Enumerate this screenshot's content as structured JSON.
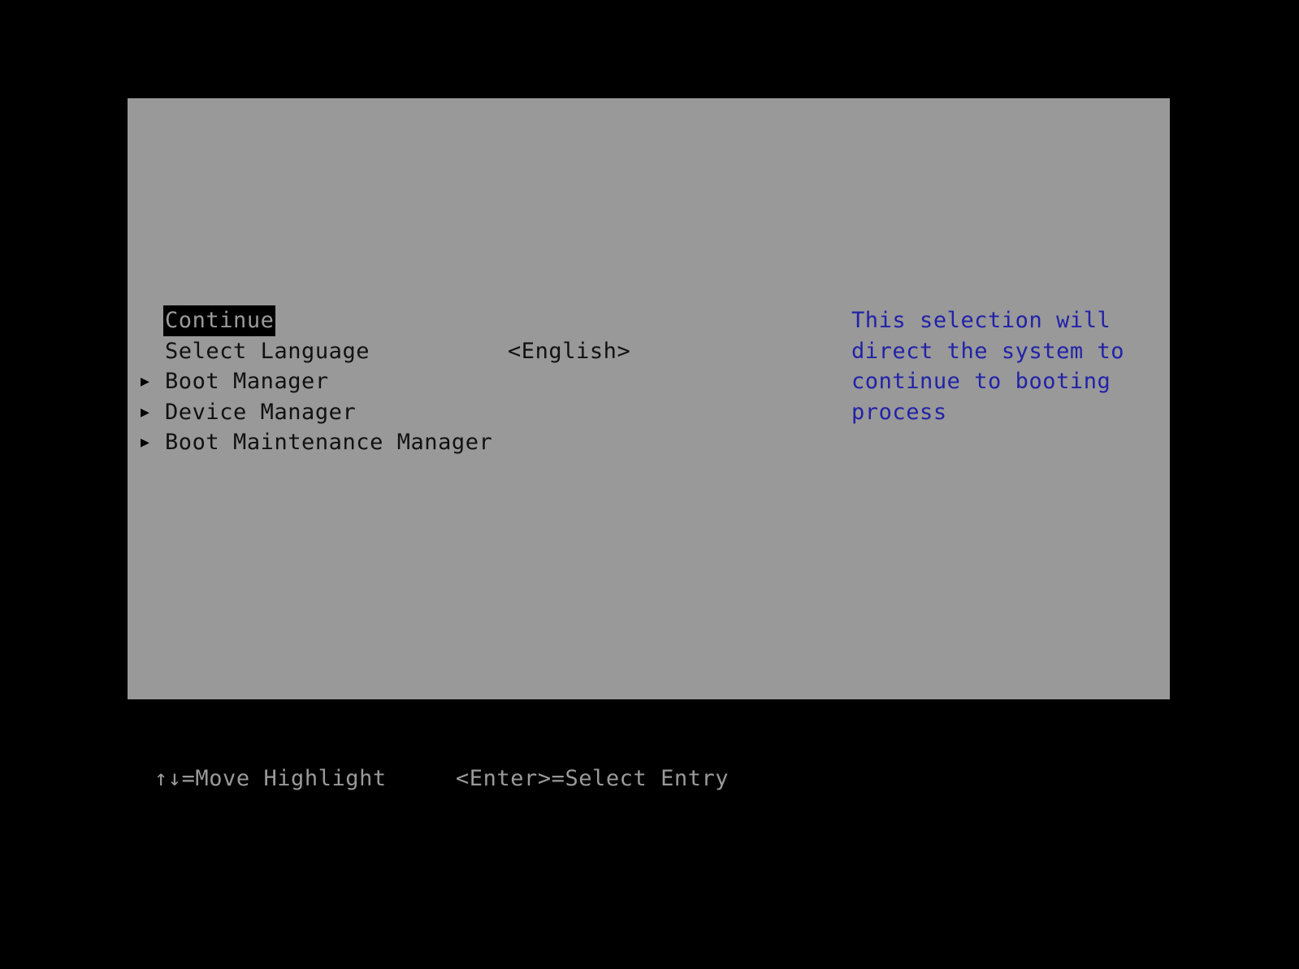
{
  "screen": {
    "kind": "uefi-setup-front-page",
    "background_color": "#000000",
    "panel_color": "#999999",
    "text_color": "#111111",
    "help_text_color": "#2222a8",
    "highlight_background": "#000000",
    "highlight_text_color": "#9a9a9a"
  },
  "menu": {
    "items": [
      {
        "label": "Continue",
        "value": "",
        "arrow": "",
        "has_submenu": false,
        "selected": true
      },
      {
        "label": "Select Language",
        "value": "<English>",
        "arrow": "",
        "has_submenu": false,
        "selected": false
      },
      {
        "label": "Boot Manager",
        "value": "",
        "arrow": "▶",
        "has_submenu": true,
        "selected": false
      },
      {
        "label": "Device Manager",
        "value": "",
        "arrow": "▶",
        "has_submenu": true,
        "selected": false
      },
      {
        "label": "Boot Maintenance Manager",
        "value": "",
        "arrow": "▶",
        "has_submenu": true,
        "selected": false
      }
    ]
  },
  "help": {
    "lines": [
      "This selection will",
      "direct the system to",
      "continue to booting",
      "process"
    ]
  },
  "status_bar": {
    "move_highlight": "↑↓=Move Highlight",
    "select_entry": "<Enter>=Select Entry"
  }
}
